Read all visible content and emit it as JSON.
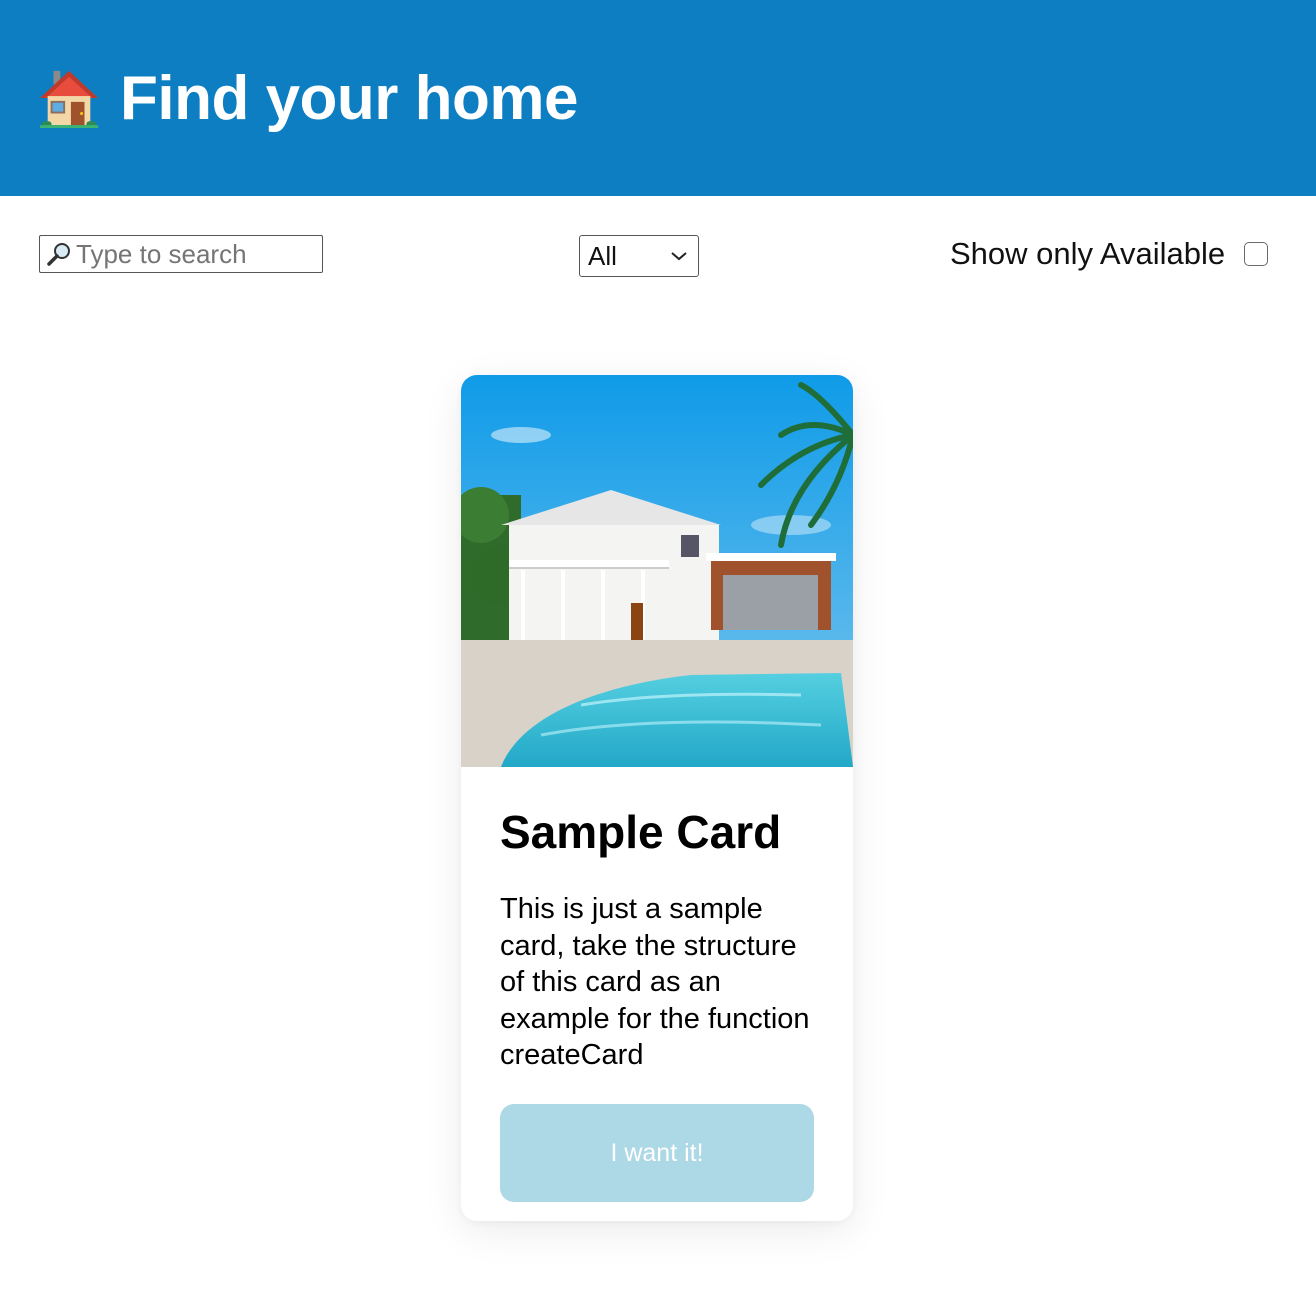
{
  "header": {
    "title": "Find your home",
    "background_color": "#0d7ec1",
    "icon": "house-icon"
  },
  "filters": {
    "search": {
      "icon": "magnifying-glass-icon",
      "placeholder": "Type to search",
      "value": ""
    },
    "category_select": {
      "selected": "All"
    },
    "available_toggle": {
      "label": "Show only Available",
      "checked": false
    }
  },
  "cards": [
    {
      "image": "house-with-pool-photo",
      "title": "Sample Card",
      "description": "This is just a sample card, take the structure of this card as an example for the function createCard",
      "button_label": "I want it!",
      "button_color": "#add8e6"
    }
  ]
}
